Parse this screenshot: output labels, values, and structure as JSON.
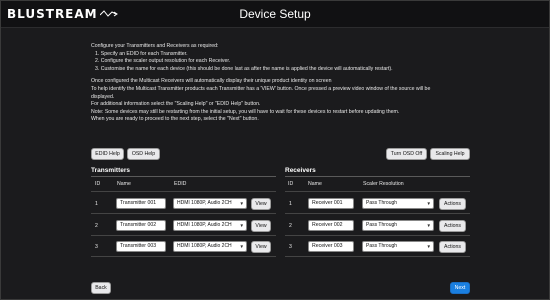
{
  "header": {
    "brand": "BLUSTREAM",
    "title": "Device Setup"
  },
  "intro": {
    "lines": [
      "Configure your Transmitters and Receivers as required:",
      "1.  Specify an EDID for each Transmitter.",
      "2.  Configure the scaler output resolution for each Receiver.",
      "3.  Customise the name for each device (this should be done last as after the name is applied the device will automatically restart).",
      "",
      "Once configured the Multicast Receivers will automatically display their unique product identity on screen",
      "To help identify the Multicast Transmitter products each Transmitter has a 'VIEW' button. Once pressed a preview video window of the source will be",
      "displayed.",
      "For additional information select the \"Scaling Help\" or \"EDID Help\" button.",
      "Note: Some devices may still be restarting from the initial setup, you will have to wait for these devices to restart before updating them.",
      "When you are ready to proceed to the next step, select the \"Next\" button."
    ]
  },
  "toolbar": {
    "edid_help": "EDID Help",
    "osd_help": "OSD Help",
    "turn_osd_off": "Turn OSD Off",
    "scaling_help": "Scaling Help"
  },
  "transmitters": {
    "title": "Transmitters",
    "columns": {
      "id": "ID",
      "name": "Name",
      "edid": "EDID"
    },
    "rows": [
      {
        "id": "1",
        "name": "Transmitter 001",
        "edid": "HDMI 1080P, Audio 2CH",
        "view": "View"
      },
      {
        "id": "2",
        "name": "Transmitter 002",
        "edid": "HDMI 1080P, Audio 2CH",
        "view": "View"
      },
      {
        "id": "3",
        "name": "Transmitter 003",
        "edid": "HDMI 1080P, Audio 2CH",
        "view": "View"
      }
    ]
  },
  "receivers": {
    "title": "Receivers",
    "columns": {
      "id": "ID",
      "name": "Name",
      "scaler": "Scaler Resolution"
    },
    "rows": [
      {
        "id": "1",
        "name": "Receiver 001",
        "scaler": "Pass Through",
        "actions": "Actions"
      },
      {
        "id": "2",
        "name": "Receiver 002",
        "scaler": "Pass Through",
        "actions": "Actions"
      },
      {
        "id": "3",
        "name": "Receiver 003",
        "scaler": "Pass Through",
        "actions": "Actions"
      }
    ]
  },
  "footer": {
    "back": "Back",
    "next": "Next"
  },
  "colors": {
    "background": "#1b1b1d",
    "accent": "#1a7fe0",
    "button": "#e9e9eb"
  }
}
